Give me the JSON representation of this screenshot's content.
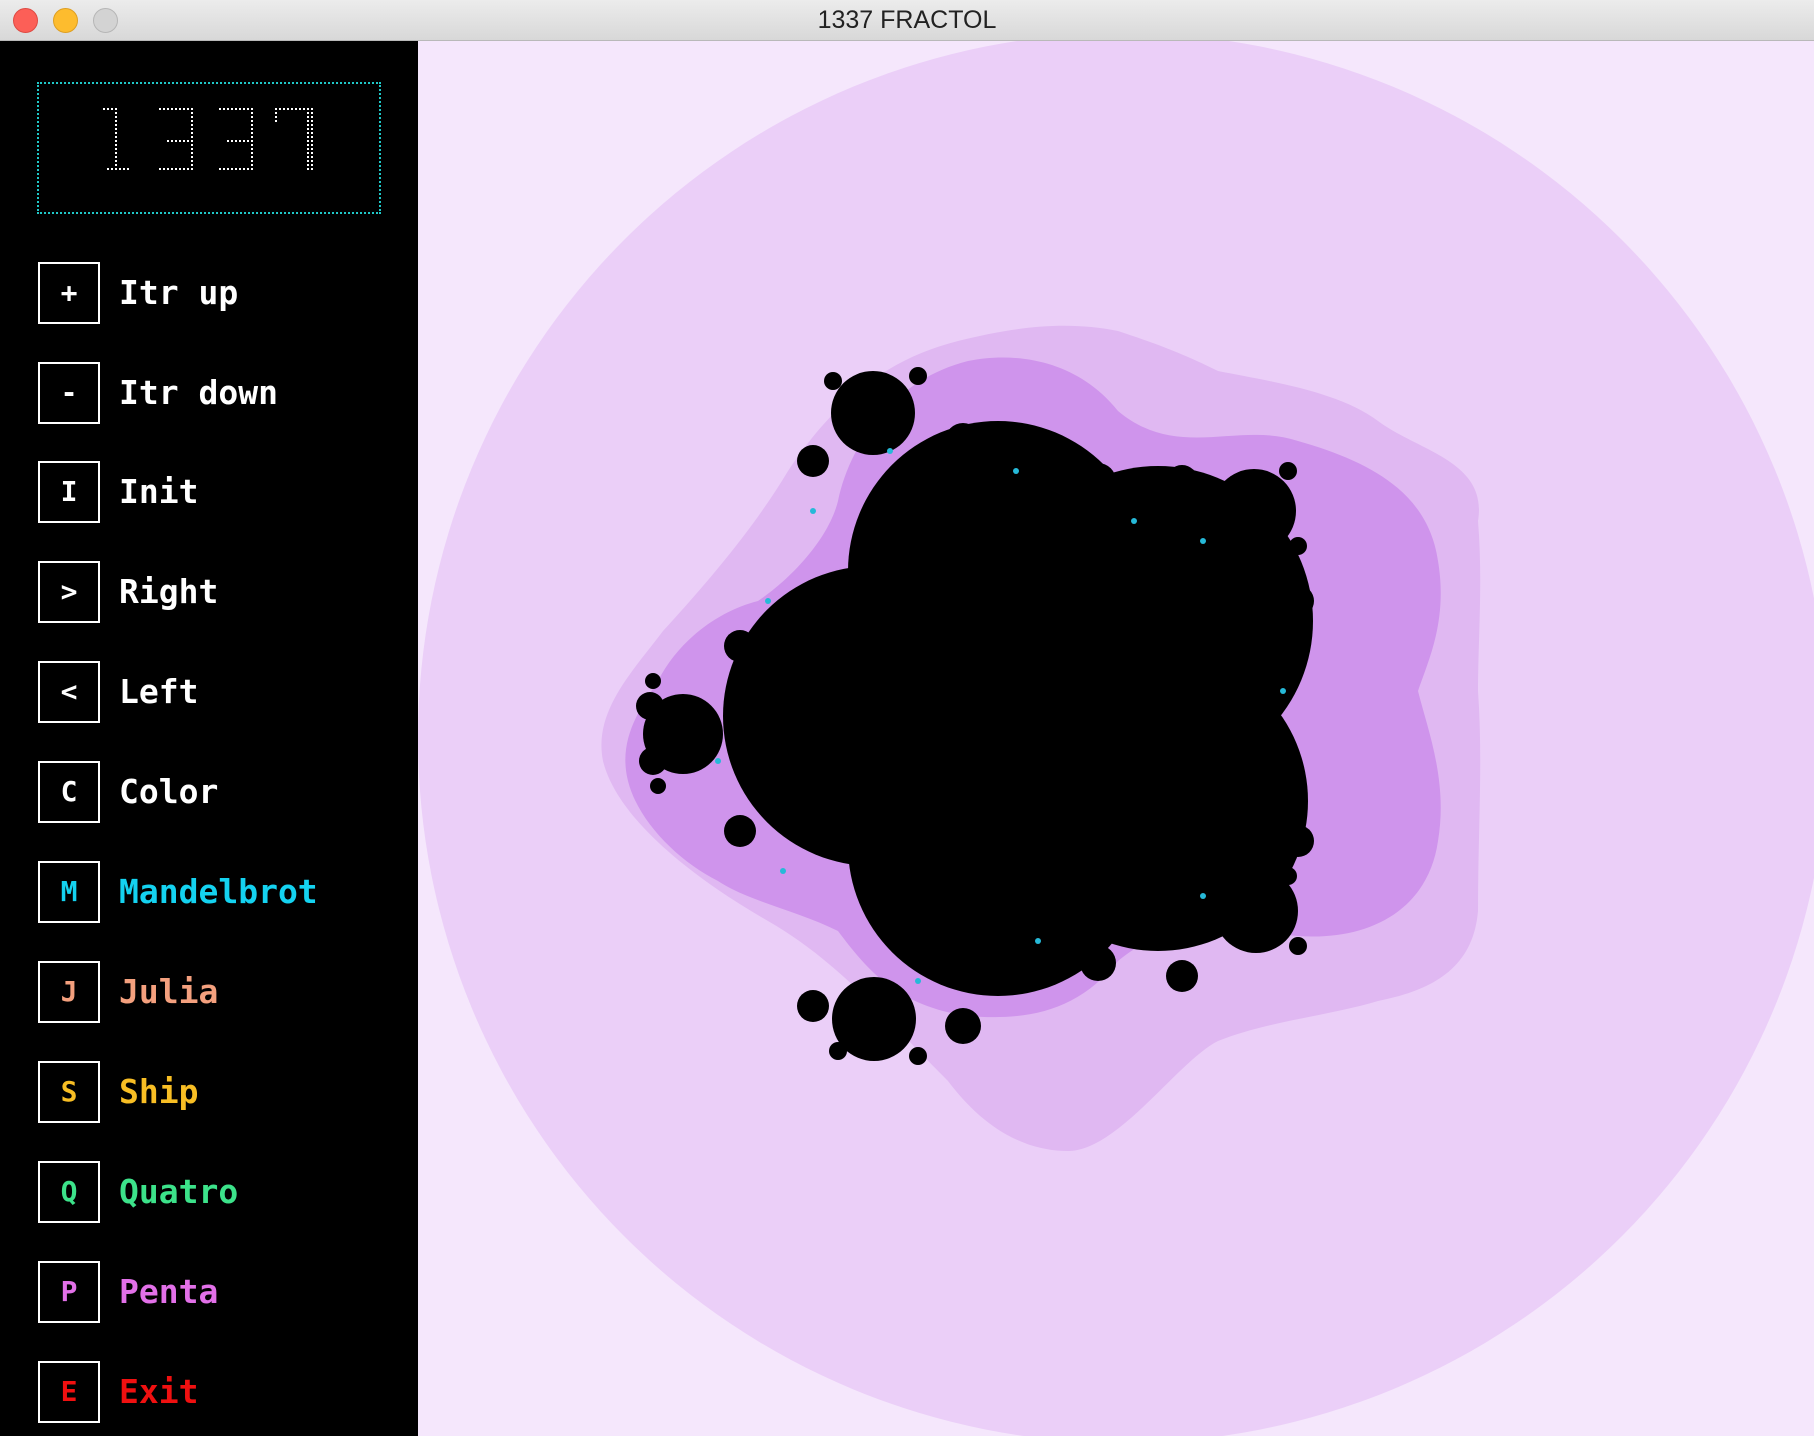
{
  "window": {
    "title": "1337 FRACTOL",
    "buttons": [
      "close",
      "minimize",
      "zoom"
    ]
  },
  "logo": {
    "text": "1337",
    "color": "#ffffff",
    "border_color": "#1fc8c8"
  },
  "menu": [
    {
      "key": "+",
      "label": "Itr up",
      "color": "#ffffff"
    },
    {
      "key": "-",
      "label": "Itr down",
      "color": "#ffffff"
    },
    {
      "key": "I",
      "label": "Init",
      "color": "#ffffff"
    },
    {
      "key": ">",
      "label": "Right",
      "color": "#ffffff"
    },
    {
      "key": "<",
      "label": "Left",
      "color": "#ffffff"
    },
    {
      "key": "C",
      "label": "Color",
      "color": "#ffffff"
    },
    {
      "key": "M",
      "label": "Mandelbrot",
      "color": "#14d2f0"
    },
    {
      "key": "J",
      "label": "Julia",
      "color": "#f4a07e"
    },
    {
      "key": "S",
      "label": "Ship",
      "color": "#f8be24"
    },
    {
      "key": "Q",
      "label": "Quatro",
      "color": "#3ce28a"
    },
    {
      "key": "P",
      "label": "Penta",
      "color": "#e270e8"
    },
    {
      "key": "E",
      "label": "Exit",
      "color": "#f01010"
    }
  ],
  "fractal": {
    "name": "Penta",
    "colors": {
      "background": "#f5e7fc",
      "outer_band": "#ebcff8",
      "mid_band": "#e0b8f2",
      "inner_band": "#cf94ec",
      "edge": "#a94fd8",
      "accent": "#26b9d8",
      "set": "#000000"
    }
  }
}
